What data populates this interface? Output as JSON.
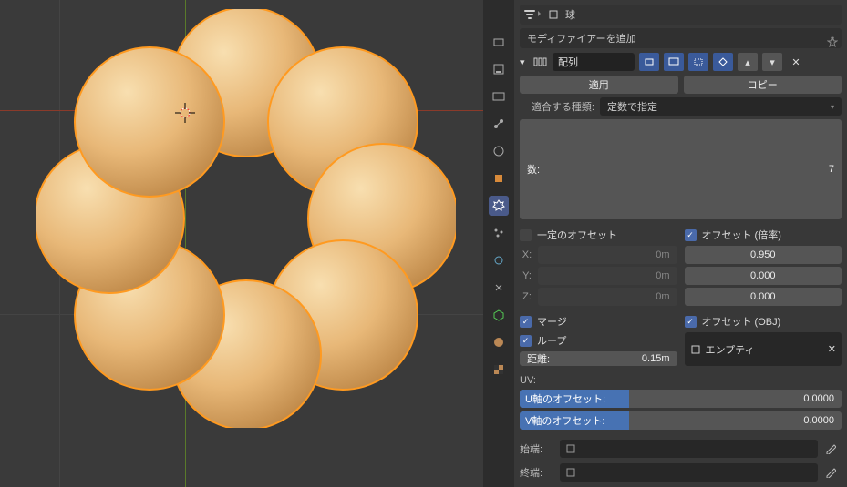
{
  "header": {
    "object_icon_name": "mesh-icon",
    "object_name": "球"
  },
  "add_modifier_label": "モディファイアーを追加",
  "modifier": {
    "name": "配列",
    "btn_apply": "適用",
    "btn_copy": "コピー",
    "fit_type_label": "適合する種類:",
    "fit_type_value": "定数で指定",
    "count_label": "数:",
    "count_value": "7",
    "constant_offset_label": "一定のオフセット",
    "constant_offset_checked": false,
    "constant_x_label": "X:",
    "constant_x_value": "0m",
    "constant_y_label": "Y:",
    "constant_y_value": "0m",
    "constant_z_label": "Z:",
    "constant_z_value": "0m",
    "relative_offset_label": "オフセット (倍率)",
    "relative_offset_checked": true,
    "relative_x_value": "0.950",
    "relative_y_value": "0.000",
    "relative_z_value": "0.000",
    "merge_label": "マージ",
    "merge_checked": true,
    "loop_label": "ループ",
    "loop_checked": true,
    "dist_label": "距離:",
    "dist_value": "0.15m",
    "object_offset_label": "オフセット (OBJ)",
    "object_offset_checked": true,
    "object_offset_target": "エンプティ",
    "uv_label": "UV:",
    "u_offset_label": "U軸のオフセット:",
    "u_offset_value": "0.0000",
    "v_offset_label": "V軸のオフセット:",
    "v_offset_value": "0.0000",
    "start_cap_label": "始端:",
    "end_cap_label": "終端:"
  }
}
